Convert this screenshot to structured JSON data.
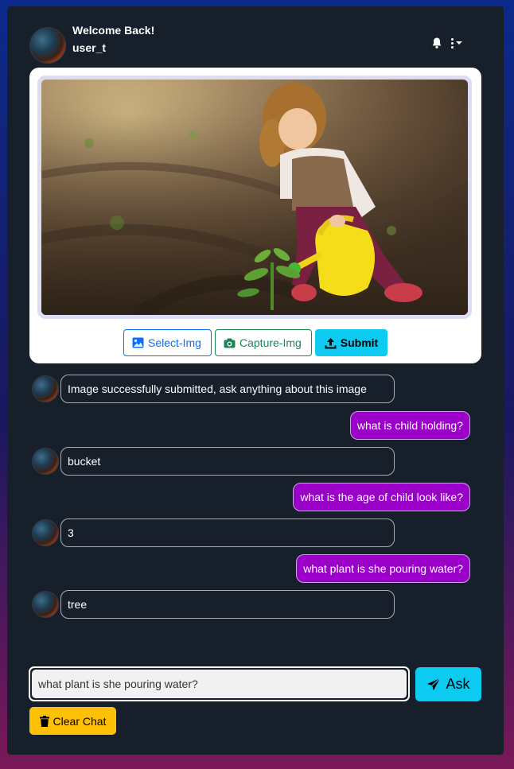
{
  "header": {
    "welcome": "Welcome Back!",
    "username": "user_t",
    "icons": [
      "avatar",
      "bell-icon",
      "more-vertical-icon"
    ]
  },
  "upload": {
    "image_alt": "child watering a plant with a yellow watering can",
    "select_label": "Select-Img",
    "capture_label": "Capture-Img",
    "submit_label": "Submit"
  },
  "chat": [
    {
      "role": "bot",
      "text": "Image successfully submitted, ask anything about this image"
    },
    {
      "role": "user",
      "text": "what is child holding?"
    },
    {
      "role": "bot",
      "text": "bucket"
    },
    {
      "role": "user",
      "text": "what is the age of child look like?"
    },
    {
      "role": "bot",
      "text": "3"
    },
    {
      "role": "user",
      "text": "what plant is she pouring water?"
    },
    {
      "role": "bot",
      "text": "tree"
    }
  ],
  "composer": {
    "input_value": "what plant is she pouring water?",
    "ask_label": "Ask",
    "clear_label": "Clear Chat"
  },
  "colors": {
    "panel": "#161f2a",
    "user_bubble": "#9b00c8",
    "ask_button": "#0dcaf0",
    "clear_button": "#ffc107",
    "select_button": "#0d6efd",
    "capture_button": "#198754"
  }
}
